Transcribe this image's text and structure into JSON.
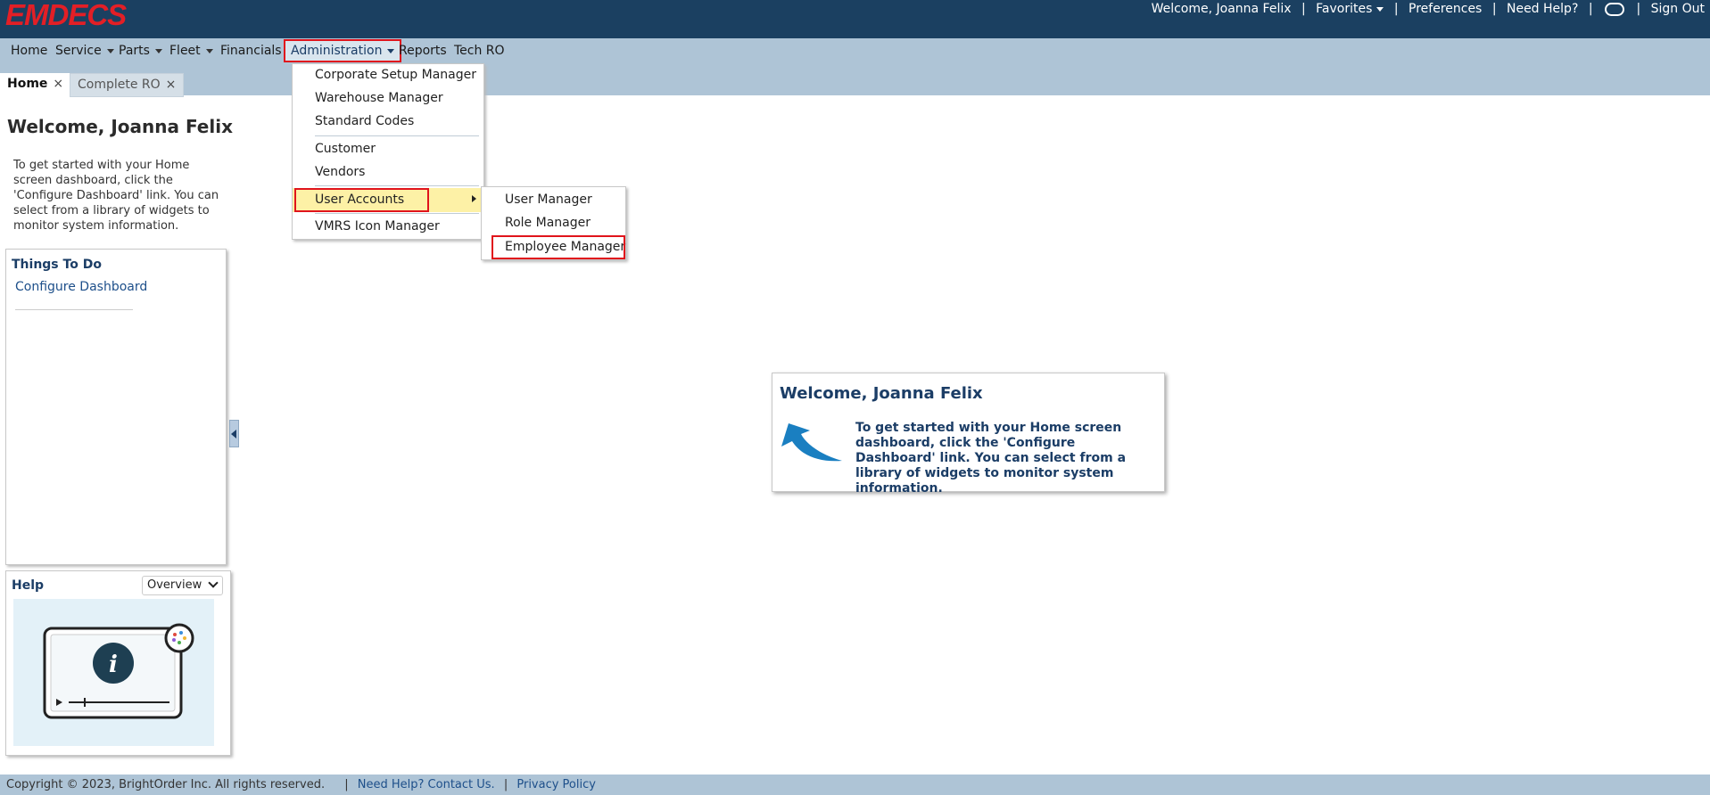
{
  "header": {
    "logo_text": "EMDECS",
    "welcome": "Welcome, Joanna Felix",
    "favorites": "Favorites",
    "preferences": "Preferences",
    "need_help": "Need Help?",
    "sign_out": "Sign Out",
    "separator": "|"
  },
  "nav": {
    "home": "Home",
    "service": "Service",
    "parts": "Parts",
    "fleet": "Fleet",
    "financials": "Financials",
    "administration": "Administration",
    "reports": "Reports",
    "tech_ro": "Tech RO"
  },
  "tabs": [
    {
      "label": "Home",
      "close": "×"
    },
    {
      "label": "Complete RO",
      "close": "×"
    }
  ],
  "sidebar": {
    "welcome_title": "Welcome, Joanna Felix",
    "welcome_text": "To get started with your Home screen dashboard, click the 'Configure Dashboard' link. You can select from a library of widgets to monitor system information.",
    "todo_title": "Things To Do",
    "todo_link": "Configure Dashboard",
    "help_title": "Help",
    "help_select_value": "Overview"
  },
  "card": {
    "title": "Welcome, Joanna Felix",
    "text": "To get started with your Home screen dashboard, click the 'Configure Dashboard' link. You can select from a library of widgets to monitor system information."
  },
  "admin_menu": {
    "items": [
      "Corporate Setup Manager",
      "Warehouse Manager",
      "Standard Codes",
      "Customer",
      "Vendors",
      "User Accounts",
      "VMRS Icon Manager"
    ]
  },
  "submenu": {
    "items": [
      "User Manager",
      "Role Manager",
      "Employee Manager"
    ]
  },
  "footer": {
    "copyright": "Copyright © 2023, BrightOrder Inc. All rights reserved.",
    "sep": "|",
    "help_link": "Need Help? Contact Us.",
    "privacy": "Privacy Policy"
  },
  "colors": {
    "header_bg": "#1b4061",
    "nav_bg": "#aec4d6",
    "brand_red": "#e31f26",
    "highlight": "#fdf1a6",
    "annotation_red": "#e0141c"
  }
}
